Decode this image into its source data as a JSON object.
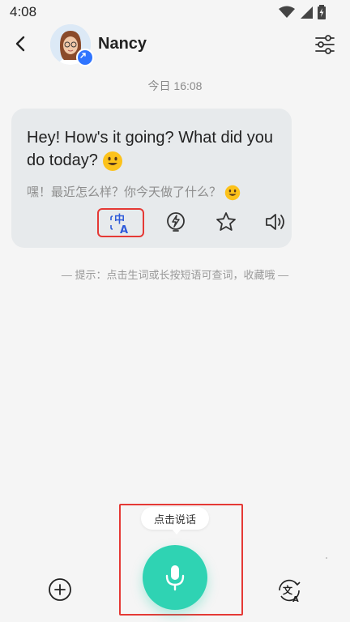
{
  "status_bar": {
    "time": "4:08"
  },
  "header": {
    "contact_name": "Nancy"
  },
  "chat": {
    "timestamp": "今日 16:08",
    "message": {
      "text_en": "Hey! How's it going? What did you do today?",
      "text_cn": "嘿！最近怎么样？你今天做了什么？"
    },
    "actions": {
      "translate_icon_text_top": "中",
      "translate_icon_text_bottom": "A"
    },
    "hint": "— 提示：点击生词或长按短语可查词，收藏哦 —"
  },
  "bottom": {
    "tooltip": "点击说话",
    "translate_icon_text": "文"
  },
  "colors": {
    "accent_green": "#2fd3b3",
    "highlight_red": "#e53935",
    "bubble_bg": "#e7eaec",
    "page_bg": "#f5f5f5",
    "badge_blue": "#2f74ff",
    "translate_icon_blue": "#2f5bd9"
  },
  "icons": {
    "back": "chevron-left-icon",
    "settings": "sliders-icon",
    "translate": "translate-icon",
    "lightning": "lightning-icon",
    "star": "star-icon",
    "speaker": "speaker-icon",
    "mic": "microphone-icon",
    "plus": "plus-circle-icon",
    "language": "language-switch-icon"
  }
}
